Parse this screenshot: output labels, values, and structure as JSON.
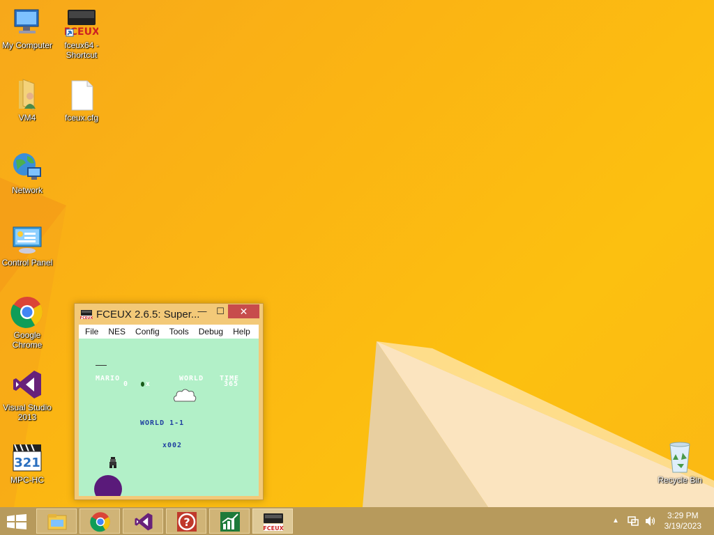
{
  "desktop": {
    "icons": [
      {
        "label": "My Computer",
        "icon": "computer-icon"
      },
      {
        "label": "fceux64 - Shortcut",
        "icon": "fceux-icon"
      },
      {
        "label": "VM4",
        "icon": "user-folder-icon"
      },
      {
        "label": "fceux.cfg",
        "icon": "file-icon"
      },
      {
        "label": "Network",
        "icon": "network-icon"
      },
      {
        "label": "Control Panel",
        "icon": "control-panel-icon"
      },
      {
        "label": "Google Chrome",
        "icon": "chrome-icon"
      },
      {
        "label": "Visual Studio 2013",
        "icon": "visual-studio-icon"
      },
      {
        "label": "MPC-HC",
        "icon": "mpc-hc-icon"
      },
      {
        "label": "Recycle Bin",
        "icon": "recycle-bin-icon"
      }
    ]
  },
  "window": {
    "title": "FCEUX 2.6.5: Super...",
    "minimize": "—",
    "maximize": "☐",
    "close": "✕",
    "menu": [
      "File",
      "NES",
      "Config",
      "Tools",
      "Debug",
      "Help"
    ]
  },
  "game": {
    "player": "MARIO",
    "score": "0",
    "coins": "x",
    "world_label": "WORLD",
    "time_label": "TIME",
    "time_value": "365",
    "world_title": "WORLD  1-1",
    "lives": "x002"
  },
  "taskbar": {
    "apps": [
      "file-explorer-icon",
      "chrome-icon",
      "visual-studio-icon",
      "help-icon",
      "chart-app-icon",
      "fceux-icon"
    ],
    "clock_time": "3:29 PM",
    "clock_date": "3/19/2023"
  }
}
